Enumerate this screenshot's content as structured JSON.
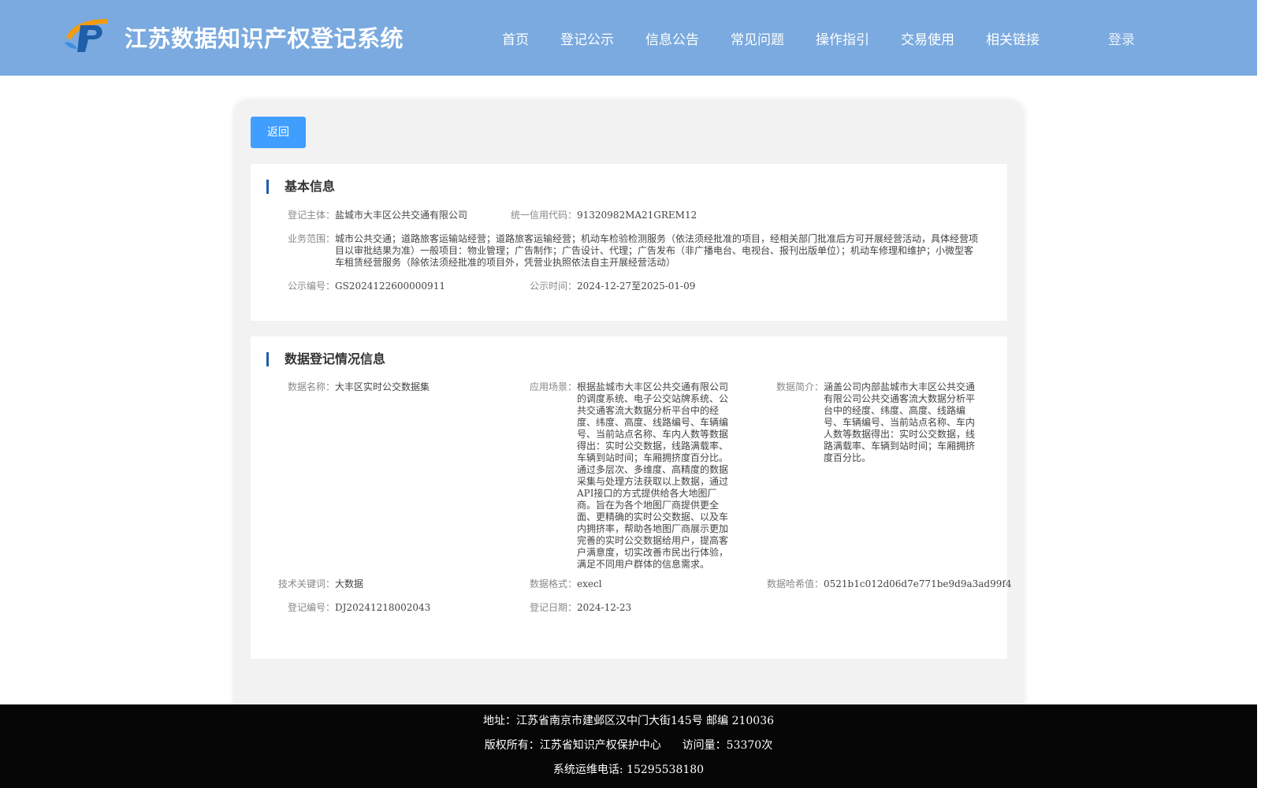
{
  "header": {
    "site_title": "江苏数据知识产权登记系统",
    "nav": [
      "首页",
      "登记公示",
      "信息公告",
      "常见问题",
      "操作指引",
      "交易使用",
      "相关链接"
    ],
    "login": "登录",
    "logo_colors": {
      "blue": "#1f5ea8",
      "orange": "#f39c12"
    },
    "background": "#7aaadf"
  },
  "main": {
    "back_button": "返回",
    "basic_info": {
      "title": "基本信息",
      "subject_label": "登记主体：",
      "subject_value": "盐城市大丰区公共交通有限公司",
      "credit_code_label": "统一信用代码：",
      "credit_code_value": "91320982MA21GREM12",
      "business_scope_label": "业务范围：",
      "business_scope_value": "城市公共交通；道路旅客运输站经营；道路旅客运输经营；机动车检验检测服务（依法须经批准的项目，经相关部门批准后方可开展经营活动，具体经营项目以审批结果为准）一般项目：物业管理；广告制作；广告设计、代理；广告发布（非广播电台、电视台、报刊出版单位）；机动车修理和维护；小微型客车租赁经营服务（除依法须经批准的项目外，凭营业执照依法自主开展经营活动）",
      "notice_no_label": "公示编号：",
      "notice_no_value": "GS2024122600000911",
      "notice_time_label": "公示时间：",
      "notice_time_value": "2024-12-27至2025-01-09"
    },
    "data_info": {
      "title": "数据登记情况信息",
      "name_label": "数据名称：",
      "name_value": "大丰区实时公交数据集",
      "scenario_label": "应用场景：",
      "scenario_value": "根据盐城市大丰区公共交通有限公司的调度系统、电子公交站牌系统、公共交通客流大数据分析平台中的经度、纬度、高度、线路编号、车辆编号、当前站点名称、车内人数等数据得出：实时公交数据，线路满载率、车辆到站时间；车厢拥挤度百分比。通过多层次、多维度、高精度的数据采集与处理方法获取以上数据，通过API接口的方式提供给各大地图厂商。旨在为各个地图厂商提供更全面、更精确的实时公交数据、以及车内拥挤率，帮助各地图厂商展示更加完善的实时公交数据给用户，提高客户满意度，切实改善市民出行体验，满足不同用户群体的信息需求。",
      "intro_label": "数据简介：",
      "intro_value": "涵盖公司内部盐城市大丰区公共交通有限公司公共交通客流大数据分析平台中的经度、纬度、高度、线路编号、车辆编号、当前站点名称、车内人数等数据得出：实时公交数据，线路满载率、车辆到站时间；车厢拥挤度百分比。",
      "keywords_label": "技术关键词：",
      "keywords_value": "大数据",
      "format_label": "数据格式：",
      "format_value": "execl",
      "hash_label": "数据哈希值：",
      "hash_value": "0521b1c012d06d7e771be9d9a3ad99f4",
      "reg_no_label": "登记编号：",
      "reg_no_value": "DJ20241218002043",
      "reg_date_label": "登记日期：",
      "reg_date_value": "2024-12-23"
    }
  },
  "footer": {
    "address": "地址：江苏省南京市建邺区汉中门大街145号 邮编 210036",
    "copyright": "版权所有：江苏省知识产权保护中心",
    "visits": "访问量：53370次",
    "phone": "系统运维电话: 15295538180"
  }
}
